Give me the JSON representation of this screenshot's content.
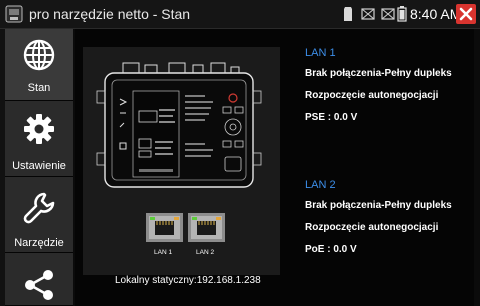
{
  "statusbar": {
    "title": "pro narzędzie netto - Stan",
    "time": "8:40 AM",
    "icons": [
      "sd-card-icon",
      "signal-icon",
      "signal-icon",
      "battery-icon"
    ]
  },
  "sidebar": {
    "items": [
      {
        "label": "Stan",
        "icon": "globe-icon",
        "active": true
      },
      {
        "label": "Ustawienie",
        "icon": "gear-icon",
        "active": false
      },
      {
        "label": "Narzędzie",
        "icon": "wrench-icon",
        "active": false
      },
      {
        "label": "",
        "icon": "share-icon",
        "active": false
      }
    ]
  },
  "device": {
    "port1_label": "LAN 1",
    "port2_label": "LAN 2"
  },
  "lan1": {
    "title": "LAN 1",
    "connection": "Brak połączenia-Pełny dupleks",
    "autoneg": "Rozpoczęcie autonegocjacji",
    "power": "PSE : 0.0 V"
  },
  "lan2": {
    "title": "LAN 2",
    "connection": "Brak połączenia-Pełny dupleks",
    "autoneg": "Rozpoczęcie autonegocjacji",
    "power": "PoE : 0.0 V"
  },
  "footer": {
    "static_ip": "Lokalny statyczny:192.168.1.238"
  },
  "colors": {
    "accent": "#3d8ee8",
    "close": "#d8342f",
    "port_led": "#5ecb3c"
  }
}
